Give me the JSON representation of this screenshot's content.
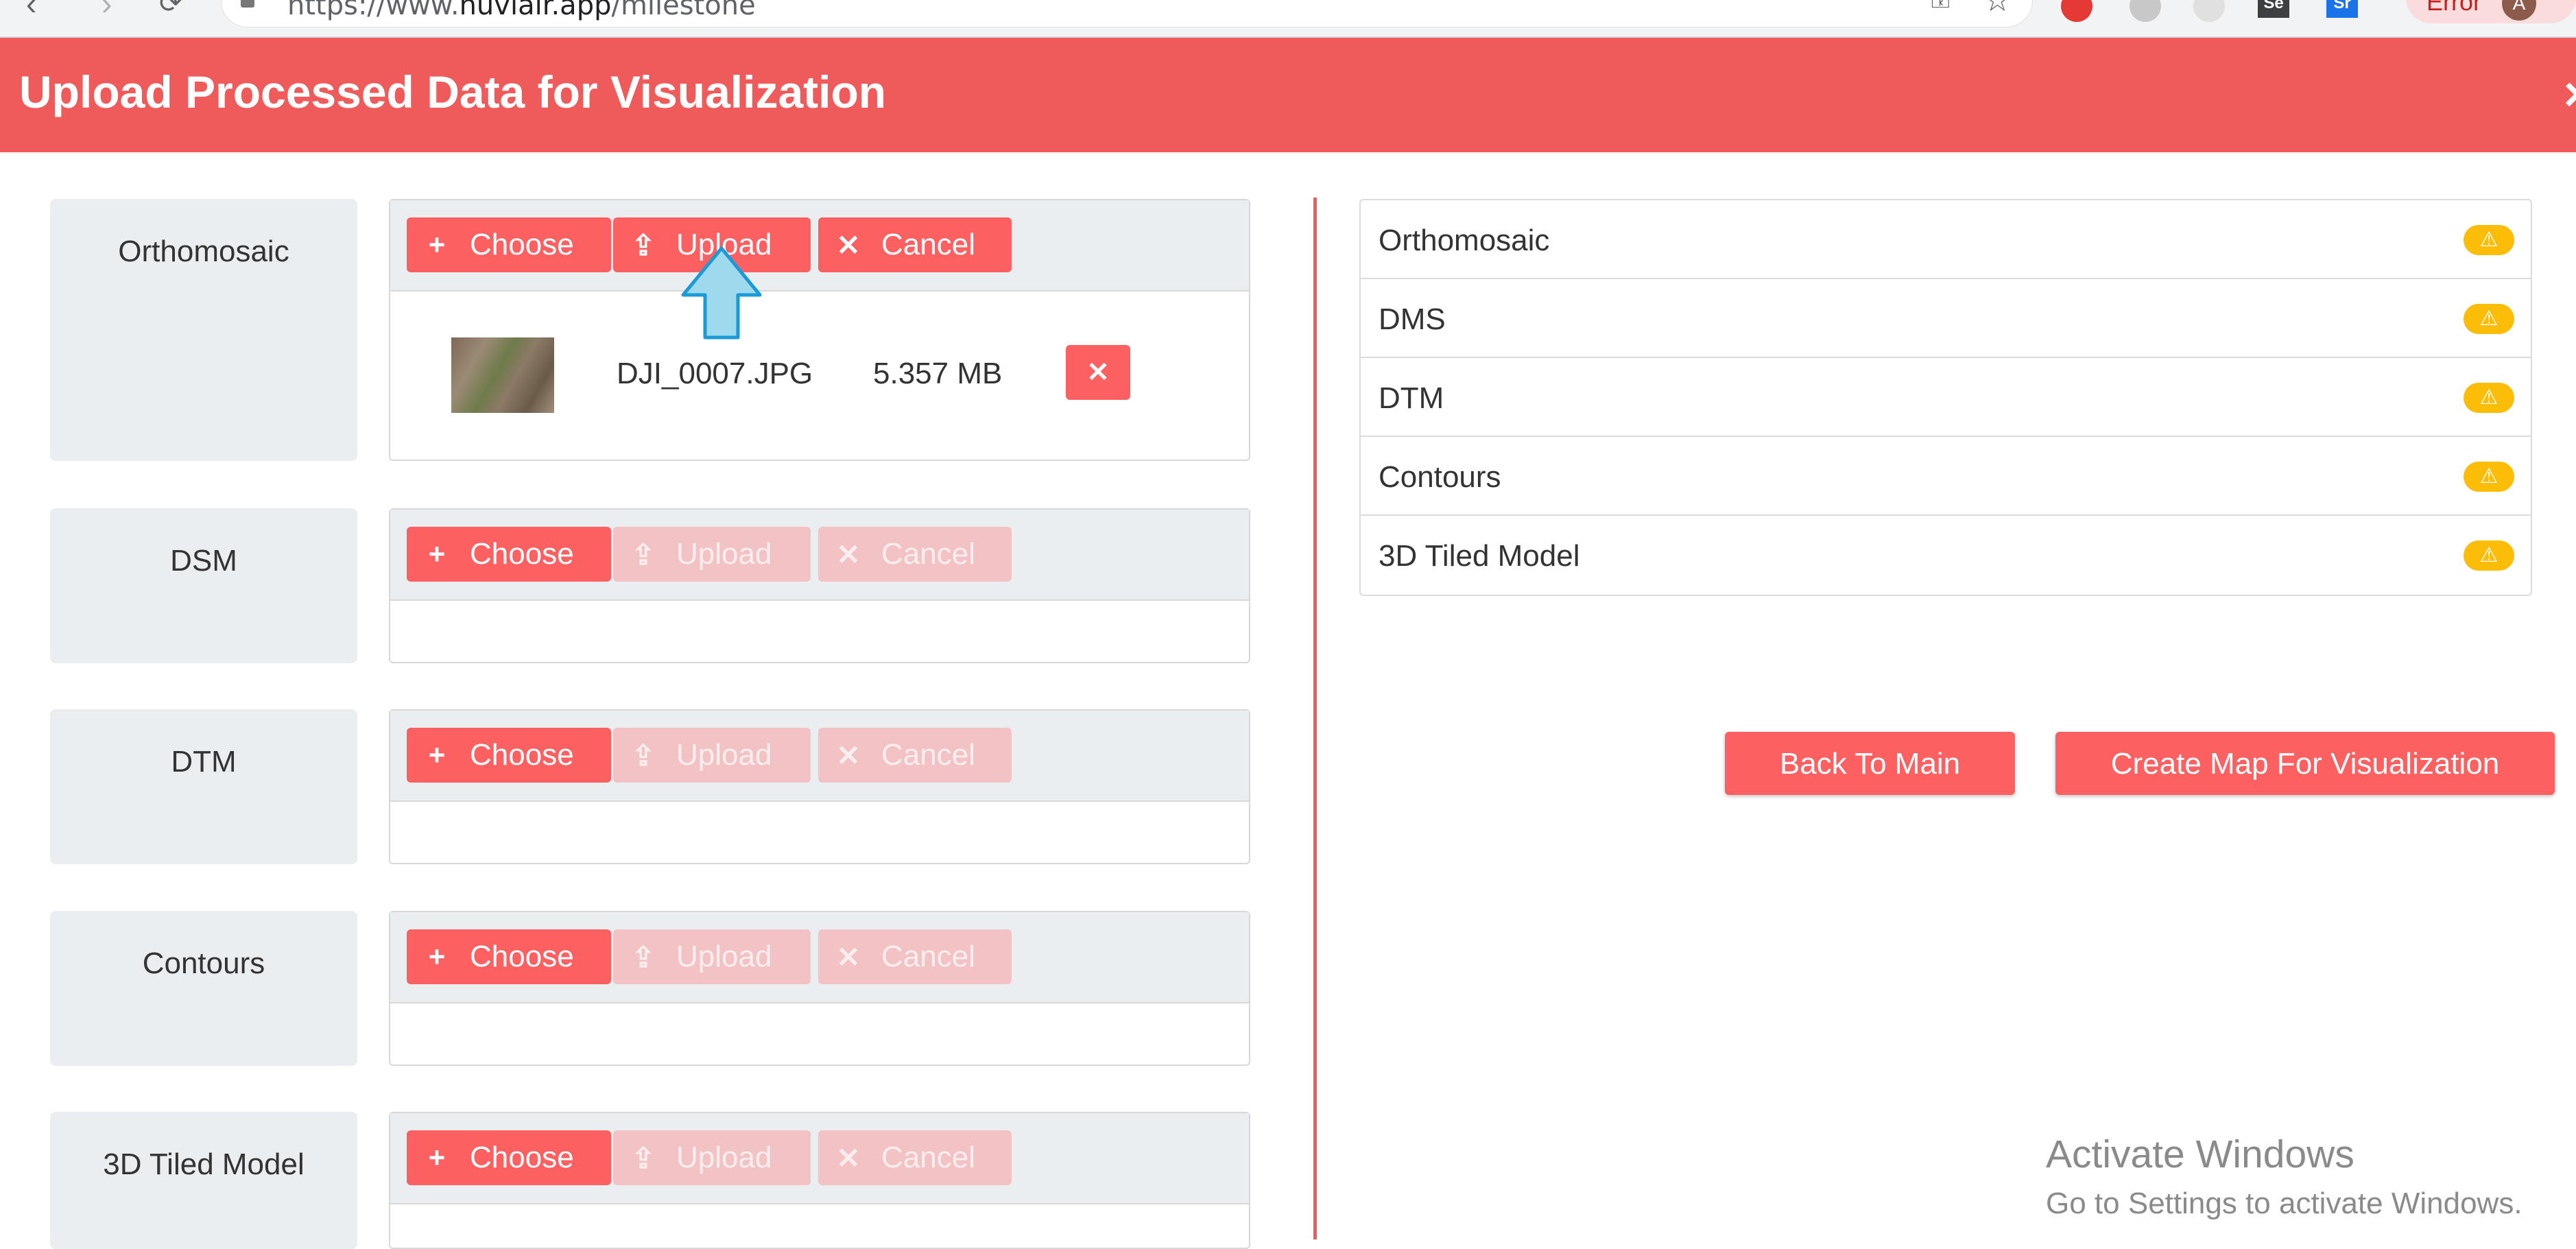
{
  "browser": {
    "url_prefix": "https://www.",
    "url_domain": "huviair.app",
    "url_path": "/milestone",
    "profile_label": "Error",
    "profile_initial": "A",
    "ext_se": "Se",
    "ext_sr": "Sr"
  },
  "dialog": {
    "title": "Upload Processed Data for Visualization",
    "close_icon": "×"
  },
  "uploaders": [
    {
      "label": "Orthomosaic",
      "choose_label": "Choose",
      "upload_label": "Upload",
      "cancel_label": "Cancel",
      "file": {
        "name": "DJI_0007.JPG",
        "size": "5.357 MB"
      }
    },
    {
      "label": "DSM",
      "choose_label": "Choose",
      "upload_label": "Upload",
      "cancel_label": "Cancel"
    },
    {
      "label": "DTM",
      "choose_label": "Choose",
      "upload_label": "Upload",
      "cancel_label": "Cancel"
    },
    {
      "label": "Contours",
      "choose_label": "Choose",
      "upload_label": "Upload",
      "cancel_label": "Cancel"
    },
    {
      "label": "3D Tiled Model",
      "choose_label": "Choose",
      "upload_label": "Upload",
      "cancel_label": "Cancel"
    }
  ],
  "status_list": [
    {
      "name": "Orthomosaic",
      "status": "warning"
    },
    {
      "name": "DMS",
      "status": "warning"
    },
    {
      "name": "DTM",
      "status": "warning"
    },
    {
      "name": "Contours",
      "status": "warning"
    },
    {
      "name": "3D Tiled Model",
      "status": "warning"
    }
  ],
  "actions": {
    "back_label": "Back To Main",
    "create_label": "Create Map For Visualization"
  },
  "watermark": {
    "line1": "Activate Windows",
    "line2": "Go to Settings to activate Windows."
  },
  "colors": {
    "header": "#ef5b5b",
    "button": "#fd6061",
    "button_disabled": "#f3c2c4",
    "warning": "#fbbd08",
    "panel": "#ebeef1",
    "annotation_arrow": "#9fd9ee"
  }
}
